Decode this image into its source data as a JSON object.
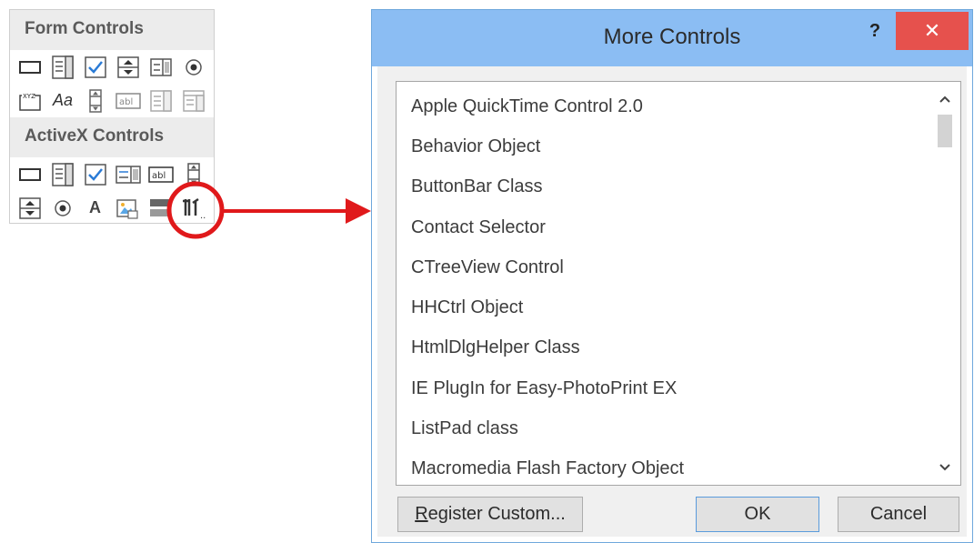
{
  "palette": {
    "form_controls_title": "Form Controls",
    "activex_controls_title": "ActiveX Controls",
    "form_icons_row1": [
      "button-icon",
      "combo-box-icon",
      "check-box-icon",
      "spin-button-icon",
      "list-box-icon",
      "option-button-icon"
    ],
    "form_icons_row2": [
      "group-box-icon",
      "label-icon",
      "scroll-bar-icon",
      "text-field-icon",
      "combo-list-edit-icon",
      "combo-dropdown-edit-icon"
    ],
    "label_icon_text": "Aa",
    "group_box_text": "XYZ",
    "text_field_text": "abl",
    "activex_icons_row1": [
      "command-button-icon",
      "combo-box-icon",
      "check-box-icon",
      "list-box-icon",
      "text-box-icon",
      "scroll-bar-icon"
    ],
    "activex_icons_row2": [
      "spin-button-icon",
      "option-button-icon",
      "label-icon",
      "image-icon",
      "toggle-button-icon",
      "more-controls-icon"
    ],
    "activex_label_text": "A",
    "more_controls_dots": "..."
  },
  "dialog": {
    "title": "More Controls",
    "help_label": "?",
    "close_label": "✕",
    "items": [
      "Apple QuickTime Control 2.0",
      "Behavior Object",
      "ButtonBar Class",
      "Contact Selector",
      "CTreeView Control",
      "HHCtrl Object",
      "HtmlDlgHelper Class",
      "IE PlugIn for Easy-PhotoPrint EX",
      "ListPad class",
      "Macromedia Flash Factory Object"
    ],
    "register_prefix": "R",
    "register_rest": "egister Custom...",
    "ok_label": "OK",
    "cancel_label": "Cancel"
  },
  "colors": {
    "titlebar": "#8bbdf3",
    "close": "#e6514d",
    "annotation": "#e0191b"
  }
}
